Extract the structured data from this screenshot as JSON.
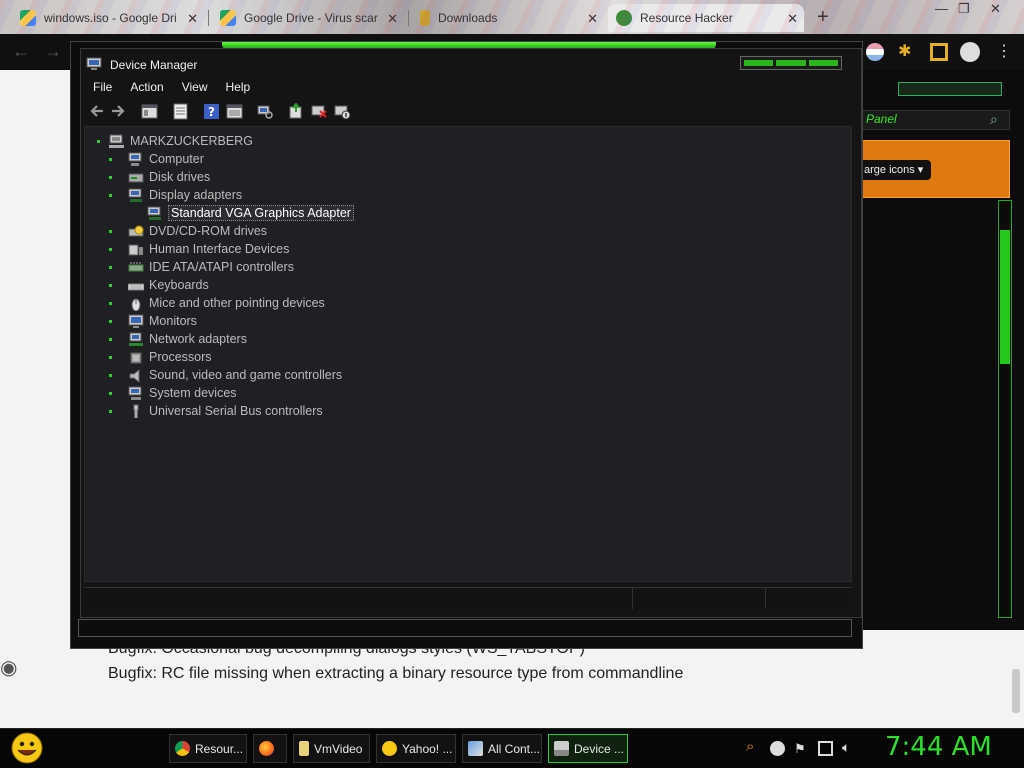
{
  "browser": {
    "tabs": [
      {
        "title": "windows.iso - Google Dri",
        "icon": "google-drive-icon"
      },
      {
        "title": "Google Drive - Virus scar",
        "icon": "google-drive-icon"
      },
      {
        "title": "Downloads",
        "icon": "download-icon"
      },
      {
        "title": "Resource Hacker",
        "icon": "resource-hacker-icon",
        "active": true
      }
    ],
    "new_tab": "+",
    "window_controls": [
      "—",
      "❐",
      "✕"
    ]
  },
  "page": {
    "lines": [
      "Bugfix:  Occasional bug decompiling dialogs styles (WS_TABSTOP)",
      "Bugfix:  RC file missing when extracting a binary resource type from commandline"
    ]
  },
  "background_window": {
    "panel_label": "Panel",
    "view_button": "arge icons ▾"
  },
  "device_manager": {
    "title": "Device Manager",
    "menu": [
      "File",
      "Action",
      "View",
      "Help"
    ],
    "toolbar_icons": [
      "back-arrow-icon",
      "forward-arrow-icon",
      "console-tree-icon",
      "properties-icon",
      "help-icon",
      "view-icon",
      "scan-hardware-icon",
      "update-driver-icon",
      "uninstall-icon",
      "disable-device-icon"
    ],
    "root": "MARKZUCKERBERG",
    "nodes": [
      {
        "label": "Computer",
        "icon": "computer-icon"
      },
      {
        "label": "Disk drives",
        "icon": "disk-drive-icon"
      },
      {
        "label": "Display adapters",
        "icon": "display-adapter-icon",
        "expanded": true
      },
      {
        "label": "Standard VGA Graphics Adapter",
        "icon": "display-adapter-icon",
        "child": true,
        "selected": true
      },
      {
        "label": "DVD/CD-ROM drives",
        "icon": "dvd-drive-icon"
      },
      {
        "label": "Human Interface Devices",
        "icon": "hid-icon"
      },
      {
        "label": "IDE ATA/ATAPI controllers",
        "icon": "ide-controller-icon"
      },
      {
        "label": "Keyboards",
        "icon": "keyboard-icon"
      },
      {
        "label": "Mice and other pointing devices",
        "icon": "mouse-icon"
      },
      {
        "label": "Monitors",
        "icon": "monitor-icon"
      },
      {
        "label": "Network adapters",
        "icon": "network-adapter-icon"
      },
      {
        "label": "Processors",
        "icon": "processor-icon"
      },
      {
        "label": "Sound, video and game controllers",
        "icon": "speaker-icon"
      },
      {
        "label": "System devices",
        "icon": "system-devices-icon"
      },
      {
        "label": "Universal Serial Bus controllers",
        "icon": "usb-icon"
      }
    ]
  },
  "taskbar": {
    "items": [
      {
        "label": "Resour...",
        "icon": "chrome-icon"
      },
      {
        "label": "",
        "icon": "firefox-icon"
      },
      {
        "label": "VmVideo",
        "icon": "folder-icon"
      },
      {
        "label": "Yahoo! ...",
        "icon": "yahoo-messenger-icon"
      },
      {
        "label": "All Cont...",
        "icon": "control-panel-icon"
      },
      {
        "label": "Device ...",
        "icon": "device-manager-icon",
        "active": true
      }
    ],
    "clock": "7:44 AM"
  }
}
